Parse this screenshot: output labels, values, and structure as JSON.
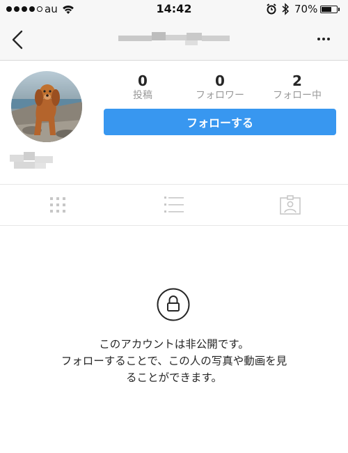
{
  "status_bar": {
    "carrier": "au",
    "time": "14:42",
    "battery_percent": "70%",
    "battery_level": 0.7,
    "signal_bars_filled": 4,
    "signal_bars_total": 5
  },
  "nav": {
    "back_icon": "chevron-left-icon",
    "more_icon": "ellipsis-icon"
  },
  "profile": {
    "stats": [
      {
        "value": "0",
        "label": "投稿"
      },
      {
        "value": "0",
        "label": "フォロワー"
      },
      {
        "value": "2",
        "label": "フォロー中"
      }
    ],
    "follow_button_label": "フォローする"
  },
  "tabs": [
    {
      "icon": "grid-icon"
    },
    {
      "icon": "list-icon"
    },
    {
      "icon": "tagged-photos-icon"
    }
  ],
  "private_notice": {
    "icon": "lock-icon",
    "line1": "このアカウントは非公開です。",
    "line2": "フォローすることで、この人の写真や動画を見",
    "line3": "ることができます。"
  },
  "colors": {
    "accent": "#3897f0",
    "text": "#262626",
    "muted": "#999999",
    "bar_bg": "#f7f7f7"
  }
}
